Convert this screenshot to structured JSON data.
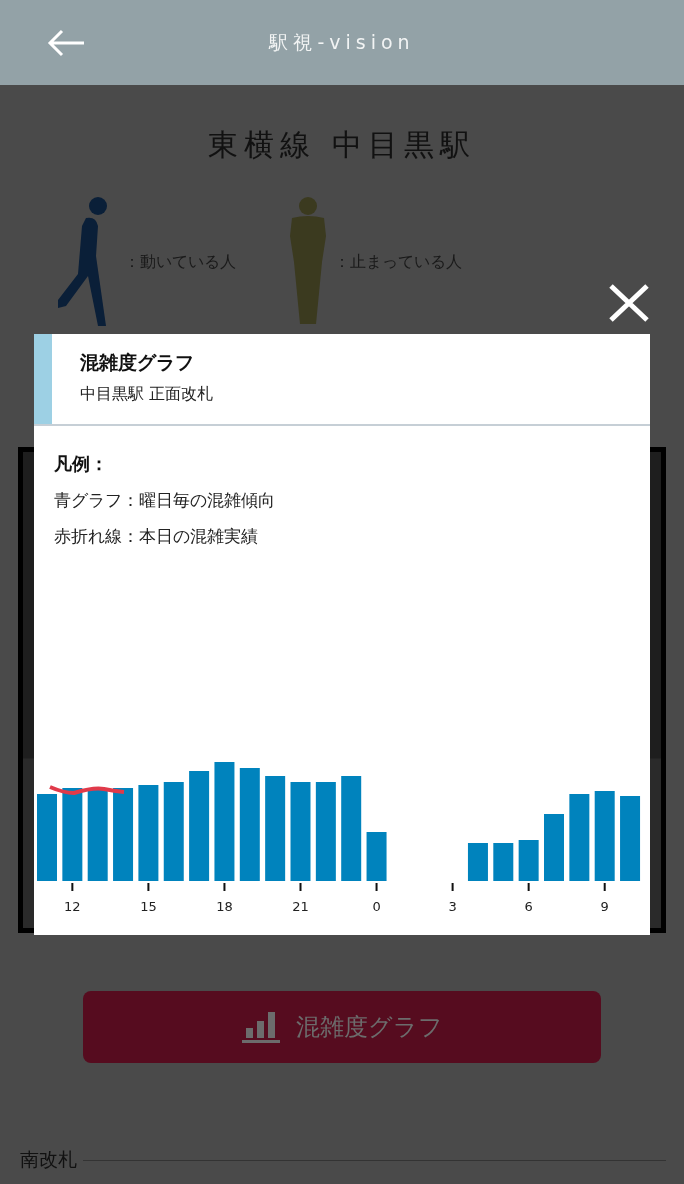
{
  "app_bar": {
    "title": "駅視-vision"
  },
  "station": "東横線 中目黒駅",
  "people_legend": [
    {
      "kind": "moving",
      "label": "：動いている人"
    },
    {
      "kind": "stopped",
      "label": "：止まっている人"
    }
  ],
  "graph_button": {
    "label": "混雑度グラフ"
  },
  "south_gate_label": "南改札",
  "modal": {
    "title": "混雑度グラフ",
    "subtitle": "中目黒駅 正面改札",
    "legend_heading": "凡例：",
    "legend_lines": [
      "青グラフ：曜日毎の混雑傾向",
      "赤折れ線：本日の混雑実績"
    ],
    "x_labels": [
      "12",
      "15",
      "18",
      "21",
      "0",
      "3",
      "6",
      "9"
    ]
  }
}
